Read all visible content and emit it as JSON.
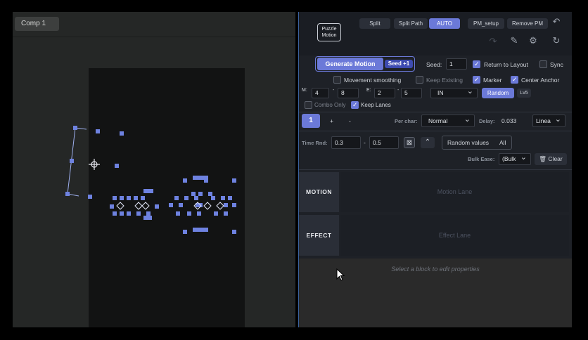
{
  "viewer": {
    "comp_tab": "Comp 1"
  },
  "header": {
    "logo_text": "Puzzle Motion",
    "split": "Split",
    "split_path": "Split Path",
    "auto": "AUTO",
    "pm_setup": "PM_setup",
    "remove_pm": "Remove PM"
  },
  "generate": {
    "button": "Generate Motion",
    "seed_badge": "Seed +1",
    "seed_label": "Seed:",
    "seed_value": "1",
    "return_to_layout": "Return to Layout",
    "return_checked": true,
    "sync": "Sync",
    "sync_checked": false,
    "movement_smoothing": "Movement smoothing",
    "keep_existing": "Keep Existing",
    "marker": "Marker",
    "center_anchor": "Center Anchor"
  },
  "params": {
    "m_label": "M:",
    "m_from": "4",
    "m_to": "8",
    "e_label": "E:",
    "e_from": "2",
    "e_to": "5",
    "dash": "-",
    "ease_dir": "IN",
    "random": "Random",
    "lv": "Lv5",
    "combo_only": "Combo Only",
    "keep_lanes": "Keep Lanes"
  },
  "lanes_bar": {
    "index": "1",
    "plus": "+",
    "minus": "-",
    "per_char_label": "Per char:",
    "per_char_value": "Normal",
    "delay_label": "Delay:",
    "delay_value": "0.033",
    "order_value": "Linea"
  },
  "time": {
    "label": "Time Rnd:",
    "from": "0.3",
    "to": "0.5",
    "random_values": "Random values",
    "all": "All",
    "bulk_ease_label": "Bulk Ease:",
    "bulk_ease_value": "(Bulk",
    "clear": "Clear"
  },
  "lanes": [
    {
      "label": "MOTION",
      "placeholder": "Motion Lane"
    },
    {
      "label": "EFFECT",
      "placeholder": "Effect Lane"
    }
  ],
  "properties": {
    "message": "Select a block to edit properties"
  },
  "colors": {
    "accent": "#6b79d8",
    "handle": "#6e82e0"
  }
}
